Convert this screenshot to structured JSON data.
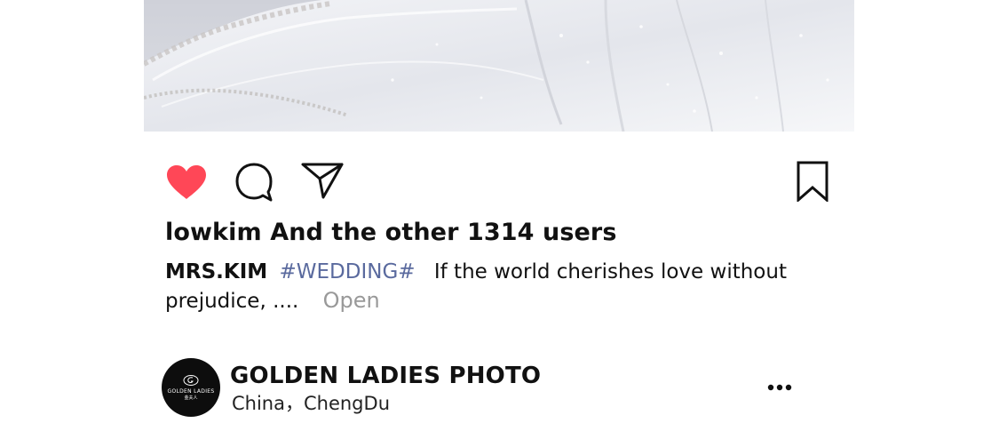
{
  "post": {
    "image_alt": "wedding dress train"
  },
  "actions": {
    "like_icon": "heart-filled-icon",
    "like_color": "#ff4757",
    "comment_icon": "comment-bubble-icon",
    "share_icon": "paper-plane-icon",
    "save_icon": "bookmark-icon"
  },
  "likes": {
    "text": "lowkim And the other 1314 users"
  },
  "caption": {
    "username": "MRS.KIM",
    "hashtag": "#WEDDING#",
    "text": "If the world cherishes love without prejudice, ....",
    "more_label": "Open",
    "hashtag_color": "#5a6a9e"
  },
  "account": {
    "name": "GOLDEN LADIES PHOTO",
    "location": "China，ChengDu",
    "avatar_text": "GOLDEN LADIES",
    "avatar_subtext": "金夫人",
    "more_icon": "more-dots-icon"
  }
}
